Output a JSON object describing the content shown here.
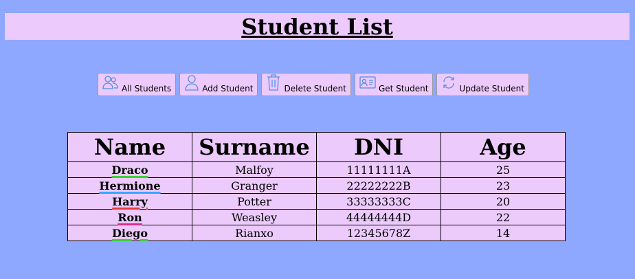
{
  "page": {
    "title": "Student List"
  },
  "toolbar": {
    "buttons": [
      {
        "label": "All Students",
        "icon": "users-icon"
      },
      {
        "label": "Add Student",
        "icon": "user-icon"
      },
      {
        "label": "Delete Student",
        "icon": "trash-icon"
      },
      {
        "label": "Get Student",
        "icon": "id-card-icon"
      },
      {
        "label": "Update Student",
        "icon": "refresh-icon"
      }
    ]
  },
  "table": {
    "headers": [
      "Name",
      "Surname",
      "DNI",
      "Age"
    ],
    "rows": [
      {
        "name": "Draco",
        "surname": "Malfoy",
        "dni": "11111111A",
        "age": "25",
        "underline": "#3ecf3e"
      },
      {
        "name": "Hermione",
        "surname": "Granger",
        "dni": "22222222B",
        "age": "23",
        "underline": "#3aa5ff"
      },
      {
        "name": "Harry",
        "surname": "Potter",
        "dni": "33333333C",
        "age": "20",
        "underline": "#e83b3b"
      },
      {
        "name": "Ron",
        "surname": "Weasley",
        "dni": "44444444D",
        "age": "22",
        "underline": "#d62f8a"
      },
      {
        "name": "Diego",
        "surname": "Rianxo",
        "dni": "12345678Z",
        "age": "14",
        "underline": "#3ecf3e"
      }
    ]
  },
  "colors": {
    "background": "#8fa8ff",
    "panel": "#eccafb",
    "icon": "#4f8fe8"
  }
}
